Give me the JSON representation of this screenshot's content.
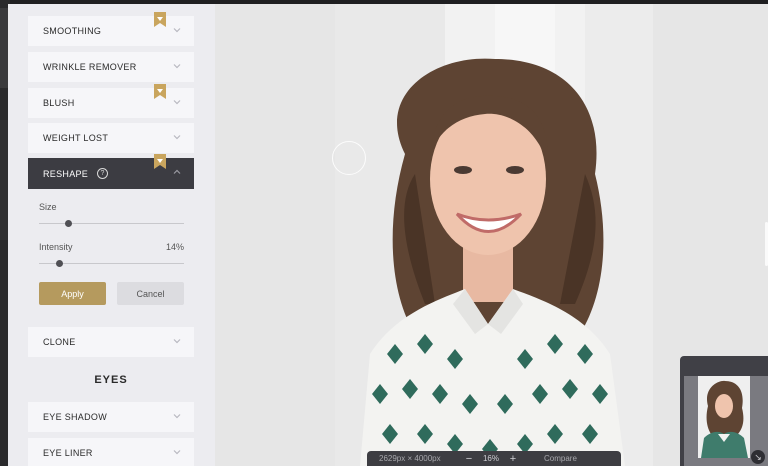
{
  "panel": {
    "items": [
      {
        "label": "SMOOTHING",
        "premium": true
      },
      {
        "label": "WRINKLE REMOVER",
        "premium": false
      },
      {
        "label": "BLUSH",
        "premium": true
      },
      {
        "label": "WEIGHT LOST",
        "premium": false
      },
      {
        "label": "RESHAPE",
        "premium": true,
        "active": true,
        "help": "?"
      }
    ],
    "reshape": {
      "size_label": "Size",
      "size_value": 0.2,
      "intensity_label": "Intensity",
      "intensity_value": "14%",
      "intensity_level": 0.14,
      "apply_label": "Apply",
      "cancel_label": "Cancel"
    },
    "clone_label": "CLONE",
    "eyes_section": "EYES",
    "eyes_items": [
      {
        "label": "EYE SHADOW"
      },
      {
        "label": "EYE LINER"
      }
    ]
  },
  "status": {
    "dimensions": "2629px × 4000px",
    "zoom_out": "−",
    "zoom": "16%",
    "zoom_in": "+",
    "compare": "Compare"
  },
  "navigator": {
    "resize_icon": "↘"
  },
  "colors": {
    "accent": "#b59a5e",
    "active_item": "#3c3c42",
    "panel_bg": "#ececf0"
  }
}
